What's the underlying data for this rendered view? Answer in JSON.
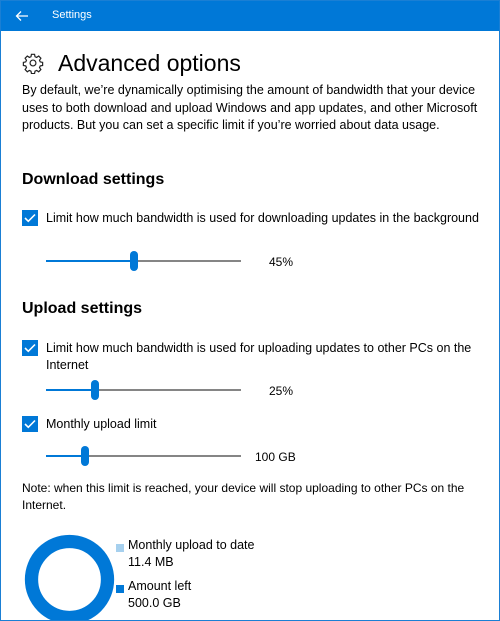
{
  "window": {
    "title": "Settings"
  },
  "page": {
    "title": "Advanced options",
    "description": "By default, we’re dynamically optimising the amount of bandwidth that your device uses to both download and upload Windows and app updates, and other Microsoft products. But you can set a specific limit if you’re worried about data usage."
  },
  "download": {
    "section_title": "Download settings",
    "limit_label": "Limit how much bandwidth is used for downloading updates in the background",
    "limit_checked": true,
    "slider_percent": 45,
    "slider_value": "45%"
  },
  "upload": {
    "section_title": "Upload settings",
    "limit_label": "Limit how much bandwidth is used for uploading updates to other PCs on the Internet",
    "limit_checked": true,
    "slider_percent": 25,
    "slider_value": "25%",
    "monthly_label": "Monthly upload limit",
    "monthly_checked": true,
    "monthly_slider_fraction": 0.2,
    "monthly_value": "100 GB",
    "note": "Note: when this limit is reached, your device will stop uploading to other PCs on the Internet."
  },
  "usage": {
    "uploaded_label": "Monthly upload to date",
    "uploaded_value": "11.4 MB",
    "left_label": "Amount left",
    "left_value": "500.0 GB",
    "uploaded_color": "#a6d0ee",
    "left_color": "#0078d7",
    "uploaded_fraction": 0.0
  },
  "colors": {
    "accent": "#0078d7"
  }
}
